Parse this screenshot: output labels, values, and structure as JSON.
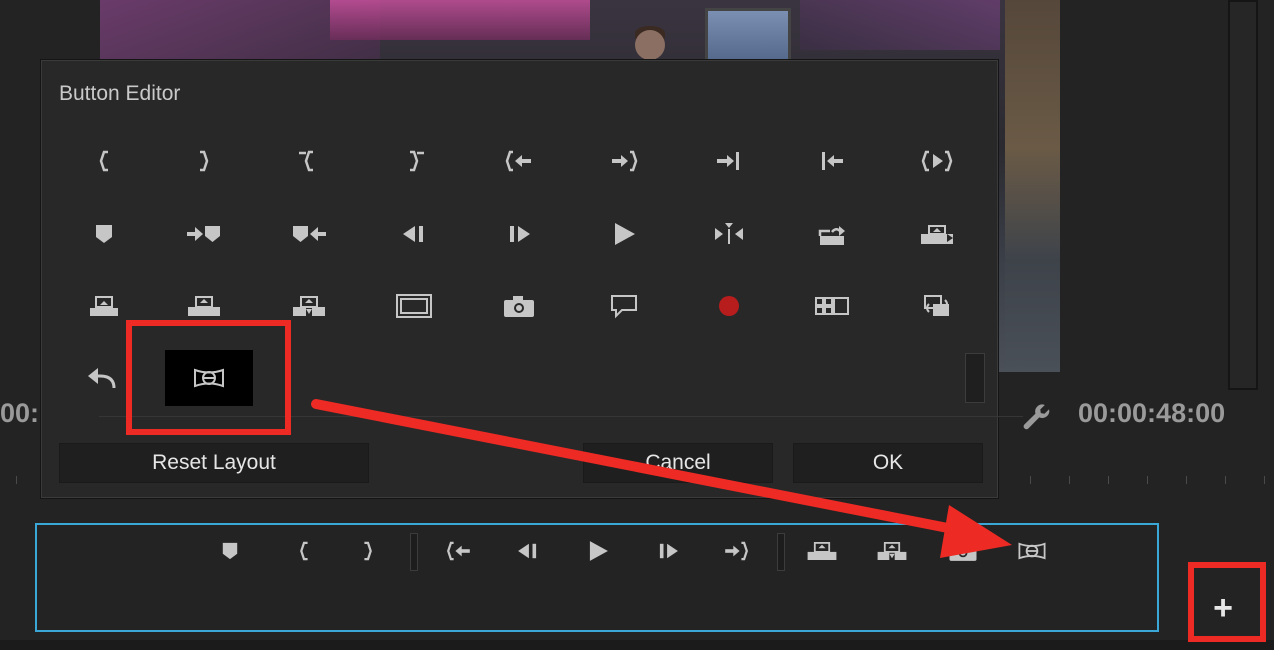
{
  "background": {
    "time_left": "00:",
    "time_right": "00:00:48:00"
  },
  "dialog": {
    "title": "Button Editor",
    "reset_label": "Reset Layout",
    "cancel_label": "Cancel",
    "ok_label": "OK"
  },
  "grid": [
    "mark-in",
    "mark-out",
    "clear-in",
    "clear-out",
    "go-to-in",
    "go-to-out",
    "step-to-end",
    "step-to-start",
    "play-in-to-out",
    "add-marker",
    "go-to-next-marker",
    "go-to-prev-marker",
    "step-back",
    "step-forward",
    "play",
    "trim",
    "export-frame-lift",
    "lift",
    "extract",
    "insert",
    "overwrite",
    "safe-margins",
    "export-frame",
    "comment",
    "record",
    "multi-camera",
    "swap",
    "undo",
    "vr-toggle"
  ],
  "toolbar": [
    "add-marker",
    "mark-in",
    "mark-out",
    "separator",
    "go-to-in",
    "step-back",
    "play",
    "step-forward",
    "go-to-out",
    "separator",
    "insert",
    "overwrite",
    "export-frame",
    "vr-toggle"
  ],
  "colors": {
    "highlight": "#ee2a24",
    "bar_border": "#3aa7d6",
    "record": "#b81d1d"
  },
  "plus_label": "+"
}
